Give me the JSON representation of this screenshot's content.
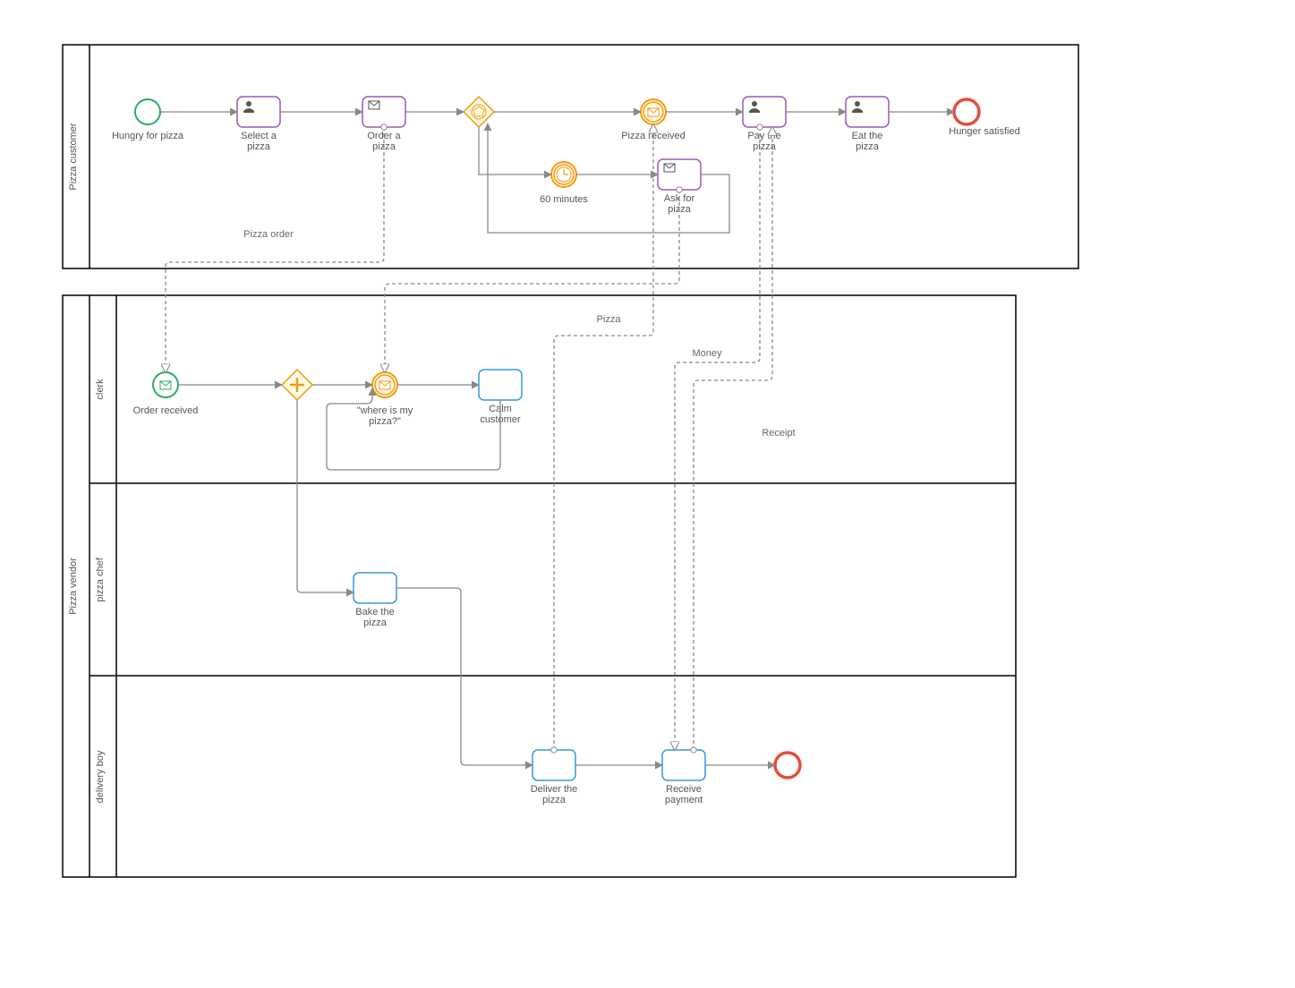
{
  "pools": {
    "customer": {
      "title": "Pizza customer"
    },
    "vendor": {
      "title": "Pizza vendor"
    }
  },
  "lanes": {
    "clerk": "clerk",
    "chef": "pizza chef",
    "delivery": "delivery boy"
  },
  "nodes": {
    "hungry": "Hungry for pizza",
    "select": "Select a\npizza",
    "order": "Order a\npizza",
    "pizzaRecv": "Pizza received",
    "pay": "Pay the\npizza",
    "eat": "Eat the\npizza",
    "hungerSat": "Hunger satisfied",
    "sixty": "60 minutes",
    "ask": "Ask for\npizza",
    "orderRecv": "Order received",
    "whereIs": "\"where is my\npizza?\"",
    "calm": "Calm\ncustomer",
    "bake": "Bake the\npizza",
    "deliver": "Deliver the\npizza",
    "receivePay": "Receive\npayment"
  },
  "messages": {
    "pizzaOrder": "Pizza order",
    "pizza": "Pizza",
    "money": "Money",
    "receipt": "Receipt"
  }
}
